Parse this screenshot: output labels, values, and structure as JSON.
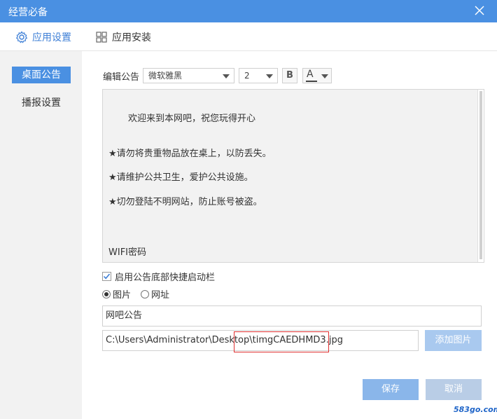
{
  "window": {
    "title": "经营必备"
  },
  "tabs": [
    {
      "label": "应用设置",
      "icon": "gear-icon",
      "active": true
    },
    {
      "label": "应用安装",
      "icon": "grid-icon",
      "active": false
    }
  ],
  "sidebar": {
    "items": [
      {
        "label": "桌面公告",
        "active": true
      },
      {
        "label": "播报设置",
        "active": false
      }
    ]
  },
  "toolbar": {
    "edit_label": "编辑公告",
    "font": "微软雅黑",
    "font_size": "2",
    "bold_label": "B",
    "color_label": "A"
  },
  "editor": {
    "lines": [
      "欢迎来到本网吧，祝您玩得开心",
      "★请勿将贵重物品放在桌上，以防丢失。",
      "★请维护公共卫生，爱护公共设施。",
      "★切勿登陆不明网站，防止账号被盗。",
      "WIFI密码"
    ]
  },
  "options": {
    "quick_bar_label": "启用公告底部快捷启动栏",
    "quick_bar_checked": true,
    "radio_image": "图片",
    "radio_url": "网址",
    "selected": "图片"
  },
  "fields": {
    "title_value": "网吧公告",
    "path_value": "C:\\Users\\Administrator\\Desktop\\timgCAEDHMD3.jpg"
  },
  "buttons": {
    "add_image": "添加图片",
    "save": "保存",
    "cancel": "取消"
  },
  "watermark": "583go.com",
  "colors": {
    "accent": "#4a90e2",
    "highlight": "#e03030"
  }
}
